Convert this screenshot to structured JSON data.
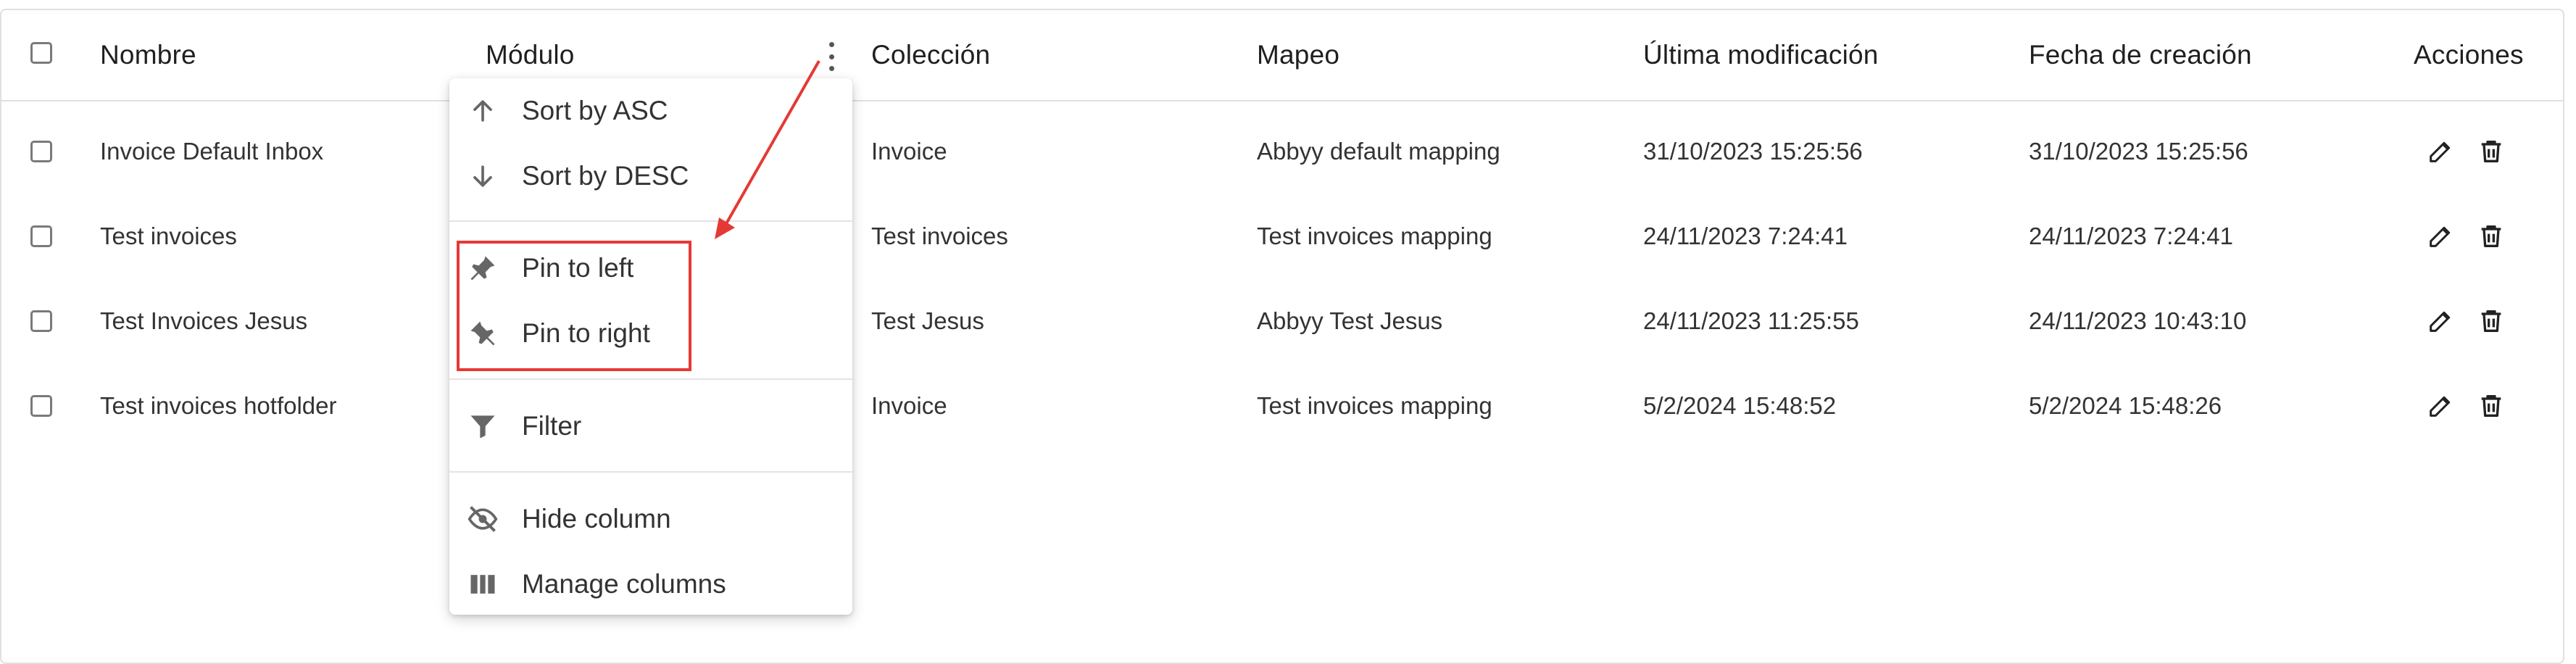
{
  "columns": {
    "nombre": "Nombre",
    "modulo": "Módulo",
    "coleccion": "Colección",
    "mapeo": "Mapeo",
    "ultima_modificacion": "Última modificación",
    "fecha_creacion": "Fecha de creación",
    "acciones": "Acciones"
  },
  "rows": [
    {
      "nombre": "Invoice Default Inbox",
      "coleccion": "Invoice",
      "mapeo": "Abbyy default mapping",
      "ultima_modificacion": "31/10/2023 15:25:56",
      "fecha_creacion": "31/10/2023 15:25:56"
    },
    {
      "nombre": "Test invoices",
      "coleccion": "Test invoices",
      "mapeo": "Test invoices mapping",
      "ultima_modificacion": "24/11/2023 7:24:41",
      "fecha_creacion": "24/11/2023 7:24:41"
    },
    {
      "nombre": "Test Invoices Jesus",
      "coleccion": "Test Jesus",
      "mapeo": "Abbyy Test Jesus",
      "ultima_modificacion": "24/11/2023 11:25:55",
      "fecha_creacion": "24/11/2023 10:43:10"
    },
    {
      "nombre": "Test invoices hotfolder",
      "coleccion": "Invoice",
      "mapeo": "Test invoices mapping",
      "ultima_modificacion": "5/2/2024 15:48:52",
      "fecha_creacion": "5/2/2024 15:48:26"
    }
  ],
  "row_actions": {
    "edit_icon": "pencil-icon",
    "delete_icon": "trash-icon"
  },
  "column_menu": {
    "sort_asc": "Sort by ASC",
    "sort_desc": "Sort by DESC",
    "pin_left": "Pin to left",
    "pin_right": "Pin to right",
    "filter": "Filter",
    "hide_column": "Hide column",
    "manage_columns": "Manage columns"
  },
  "annotation": {
    "color": "#e53935"
  },
  "colors": {
    "border": "#e0e0e0",
    "text": "#212121",
    "icon": "#555555"
  }
}
